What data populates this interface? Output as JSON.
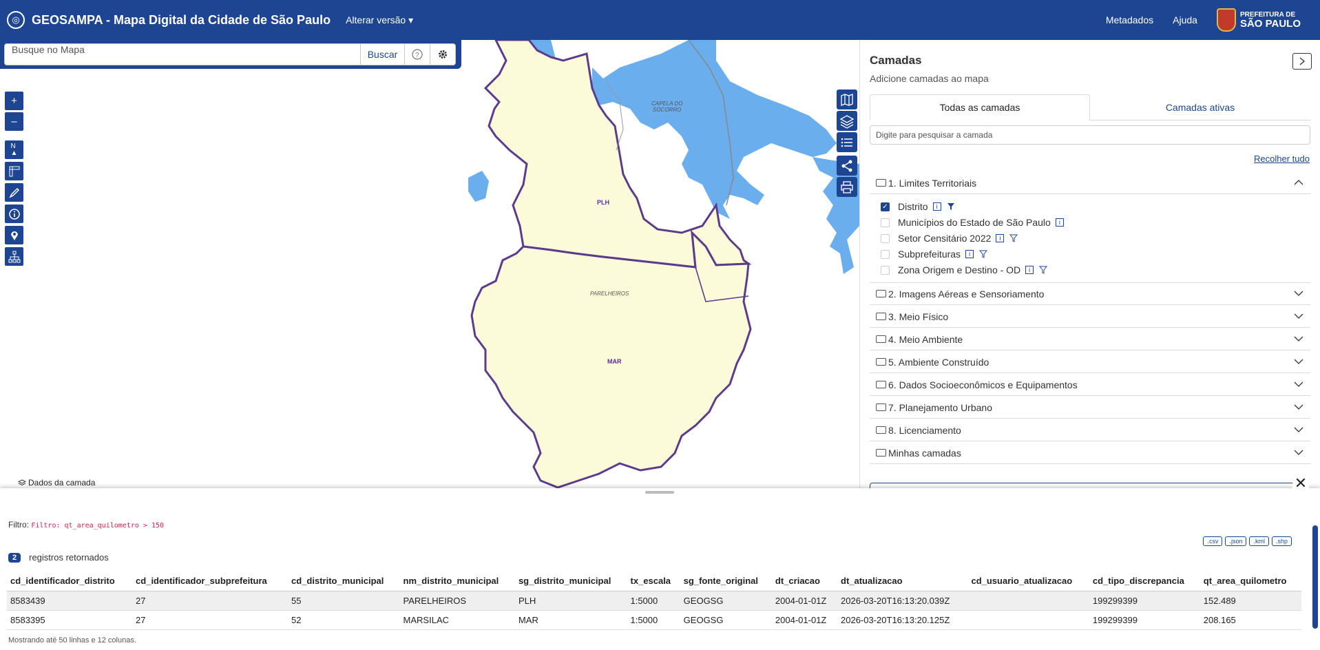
{
  "header": {
    "logo_icon": "city-globe-icon",
    "title": "GEOSAMPA - Mapa Digital da Cidade de São Paulo",
    "version_menu": "Alterar versão",
    "nav": [
      "Metadados",
      "Ajuda"
    ],
    "pref_logo_small": "PREFEITURA DE",
    "pref_logo_big": "SÃO PAULO"
  },
  "search": {
    "placeholder": "Busque no Mapa",
    "button": "Buscar",
    "help_icon": "question-circle-icon",
    "settings_icon": "gear-icon"
  },
  "map": {
    "labels": {
      "socorro_1": "CAPELA DO",
      "socorro_2": "SOCORRO",
      "plh": "PLH",
      "parelheiros": "PARELHEIROS",
      "mar": "MAR"
    },
    "colors": {
      "land": "#fbfbd9",
      "water": "#6aaeee",
      "boundary": "#5d3b8c",
      "header": "#1e4592"
    }
  },
  "left_tools": [
    {
      "name": "zoom-in",
      "glyph": "+"
    },
    {
      "name": "zoom-out",
      "glyph": "–"
    },
    {
      "name": "north-arrow",
      "glyph": "N"
    },
    {
      "name": "measure",
      "glyph": "ruler"
    },
    {
      "name": "draw",
      "glyph": "pencil"
    },
    {
      "name": "info",
      "glyph": "i"
    },
    {
      "name": "location",
      "glyph": "pin"
    },
    {
      "name": "hierarchy",
      "glyph": "tree"
    }
  ],
  "layers_panel": {
    "title": "Camadas",
    "subtitle": "Adicione camadas ao mapa",
    "tabs": [
      "Todas as camadas",
      "Camadas ativas"
    ],
    "search_placeholder": "Digite para pesquisar a camada",
    "collapse_all": "Recolher tudo",
    "groups": [
      "1. Limites Territoriais",
      "2. Imagens Aéreas e Sensoriamento",
      "3. Meio Físico",
      "4. Meio Ambiente",
      "5. Ambiente Construído",
      "6. Dados Socioeconômicos e Equipamentos",
      "7. Planejamento Urbano",
      "8. Licenciamento",
      "Minhas camadas"
    ],
    "sublayers": [
      {
        "label": "Distrito",
        "checked": true
      },
      {
        "label": "Municípios do Estado de São Paulo",
        "checked": false
      },
      {
        "label": "Setor Censitário 2022",
        "checked": false
      },
      {
        "label": "Subprefeituras",
        "checked": false
      },
      {
        "label": "Zona Origem e Destino - OD",
        "checked": false
      }
    ]
  },
  "data_drawer": {
    "tab_label": "Dados da camada",
    "filter_prefix": "Filtro:",
    "filter_code": "Filtro: qt_area_quilometro > 150",
    "exports": [
      ".csv",
      ".json",
      ".kml",
      ".shp"
    ],
    "count": "2",
    "count_label": "registros retornados",
    "columns": [
      "cd_identificador_distrito",
      "cd_identificador_subprefeitura",
      "cd_distrito_municipal",
      "nm_distrito_municipal",
      "sg_distrito_municipal",
      "tx_escala",
      "sg_fonte_original",
      "dt_criacao",
      "dt_atualizacao",
      "cd_usuario_atualizacao",
      "cd_tipo_discrepancia",
      "qt_area_quilometro"
    ],
    "rows": [
      [
        "8583439",
        "27",
        "55",
        "PARELHEIROS",
        "PLH",
        "1:5000",
        "GEOGSG",
        "2004-01-01Z",
        "2026-03-20T16:13:20.039Z",
        "",
        "199299399",
        "152.489"
      ],
      [
        "8583395",
        "27",
        "52",
        "MARSILAC",
        "MAR",
        "1:5000",
        "GEOGSG",
        "2004-01-01Z",
        "2026-03-20T16:13:20.125Z",
        "",
        "199299399",
        "208.165"
      ]
    ],
    "footer": "Mostrando até 50 linhas e 12 colunas."
  }
}
